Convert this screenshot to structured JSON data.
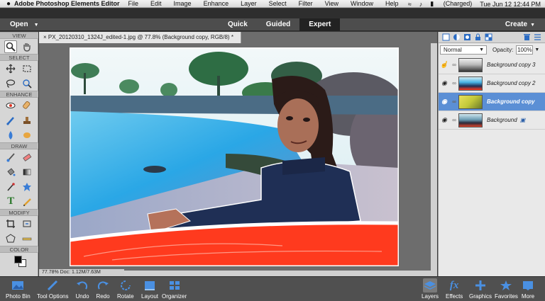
{
  "menubar": {
    "apple": "",
    "app": "Adobe Photoshop Elements Editor",
    "items": [
      "File",
      "Edit",
      "Image",
      "Enhance",
      "Layer",
      "Select",
      "Filter",
      "View",
      "Window",
      "Help"
    ],
    "battery": "(Charged)",
    "clock": "Tue Jun 12  12:44 PM"
  },
  "topbar": {
    "open": "Open",
    "modes": [
      "Quick",
      "Guided",
      "Expert"
    ],
    "active_mode": "Expert",
    "create": "Create"
  },
  "toolbox": {
    "sections": [
      "VIEW",
      "SELECT",
      "ENHANCE",
      "DRAW",
      "MODIFY",
      "COLOR"
    ]
  },
  "document": {
    "tab": "×  PX_20120310_1324J_edited-1.jpg @ 77.8% (Background copy, RGB/8) *",
    "status": "77.78%    Doc: 1.12M/7.63M"
  },
  "layers": {
    "blend_mode": "Normal",
    "opacity_label": "Opacity:",
    "opacity": "100%",
    "items": [
      {
        "name": "Background copy 3"
      },
      {
        "name": "Background copy 2"
      },
      {
        "name": "Background copy"
      },
      {
        "name": "Background"
      }
    ]
  },
  "bottombar": {
    "photo_bin": "Photo Bin",
    "tool_options": "Tool Options",
    "undo": "Undo",
    "redo": "Redo",
    "rotate": "Rotate",
    "layout": "Layout",
    "organizer": "Organizer",
    "layers": "Layers",
    "effects": "Effects",
    "graphics": "Graphics",
    "favorites": "Favorites",
    "more": "More"
  },
  "colors": {
    "accent": "#5b8fd5",
    "active_mode_bg": "#222222",
    "sky": "#ddeef2",
    "water": "#47b4e6",
    "board": "#ff3a1e"
  }
}
